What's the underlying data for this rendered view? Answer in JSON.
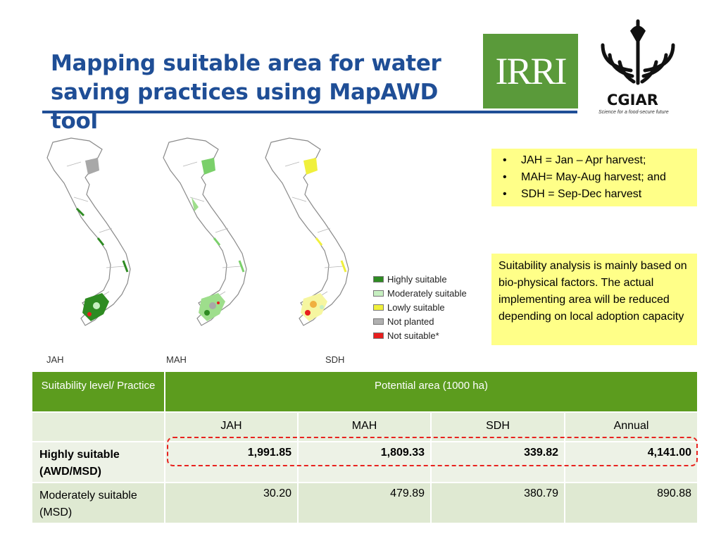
{
  "slide": {
    "title_line1": "Mapping suitable area for water",
    "title_line2": "saving practices using MapAWD tool"
  },
  "logos": {
    "irri": "IRRI",
    "cgiar": "CGIAR",
    "cgiar_tagline": "Science for a food-secure future"
  },
  "maps": {
    "labels": [
      "JAH",
      "MAH",
      "SDH"
    ],
    "legend": [
      {
        "label": "Highly suitable",
        "color": "#2e8b22"
      },
      {
        "label": "Moderately suitable",
        "color": "#c6efc0"
      },
      {
        "label": "Lowly suitable",
        "color": "#f0f03c"
      },
      {
        "label": "Not planted",
        "color": "#b0b0b0"
      },
      {
        "label": "Not suitable*",
        "color": "#e81e1e"
      }
    ]
  },
  "notes": {
    "abbreviations": [
      "JAH = Jan – Apr harvest;",
      "MAH= May-Aug harvest; and",
      "SDH = Sep-Dec harvest"
    ],
    "suitability": "Suitability analysis is mainly based on bio-physical factors. The actual implementing area will be reduced depending on local adoption capacity"
  },
  "table": {
    "header_col1": "Suitability level/ Practice",
    "header_span": "Potential area (1000 ha)",
    "columns": [
      "JAH",
      "MAH",
      "SDH",
      "Annual"
    ],
    "rows": [
      {
        "label": "Highly suitable (AWD/MSD)",
        "values": [
          "1,991.85",
          "1,809.33",
          "339.82",
          "4,141.00"
        ]
      },
      {
        "label": "Moderately suitable (MSD)",
        "values": [
          "30.20",
          "479.89",
          "380.79",
          "890.88"
        ]
      }
    ]
  },
  "colors": {
    "title": "#1f4e96",
    "table_header": "#5c9c1e",
    "note_background": "#ffff88",
    "highlight_border": "#e8231f"
  }
}
